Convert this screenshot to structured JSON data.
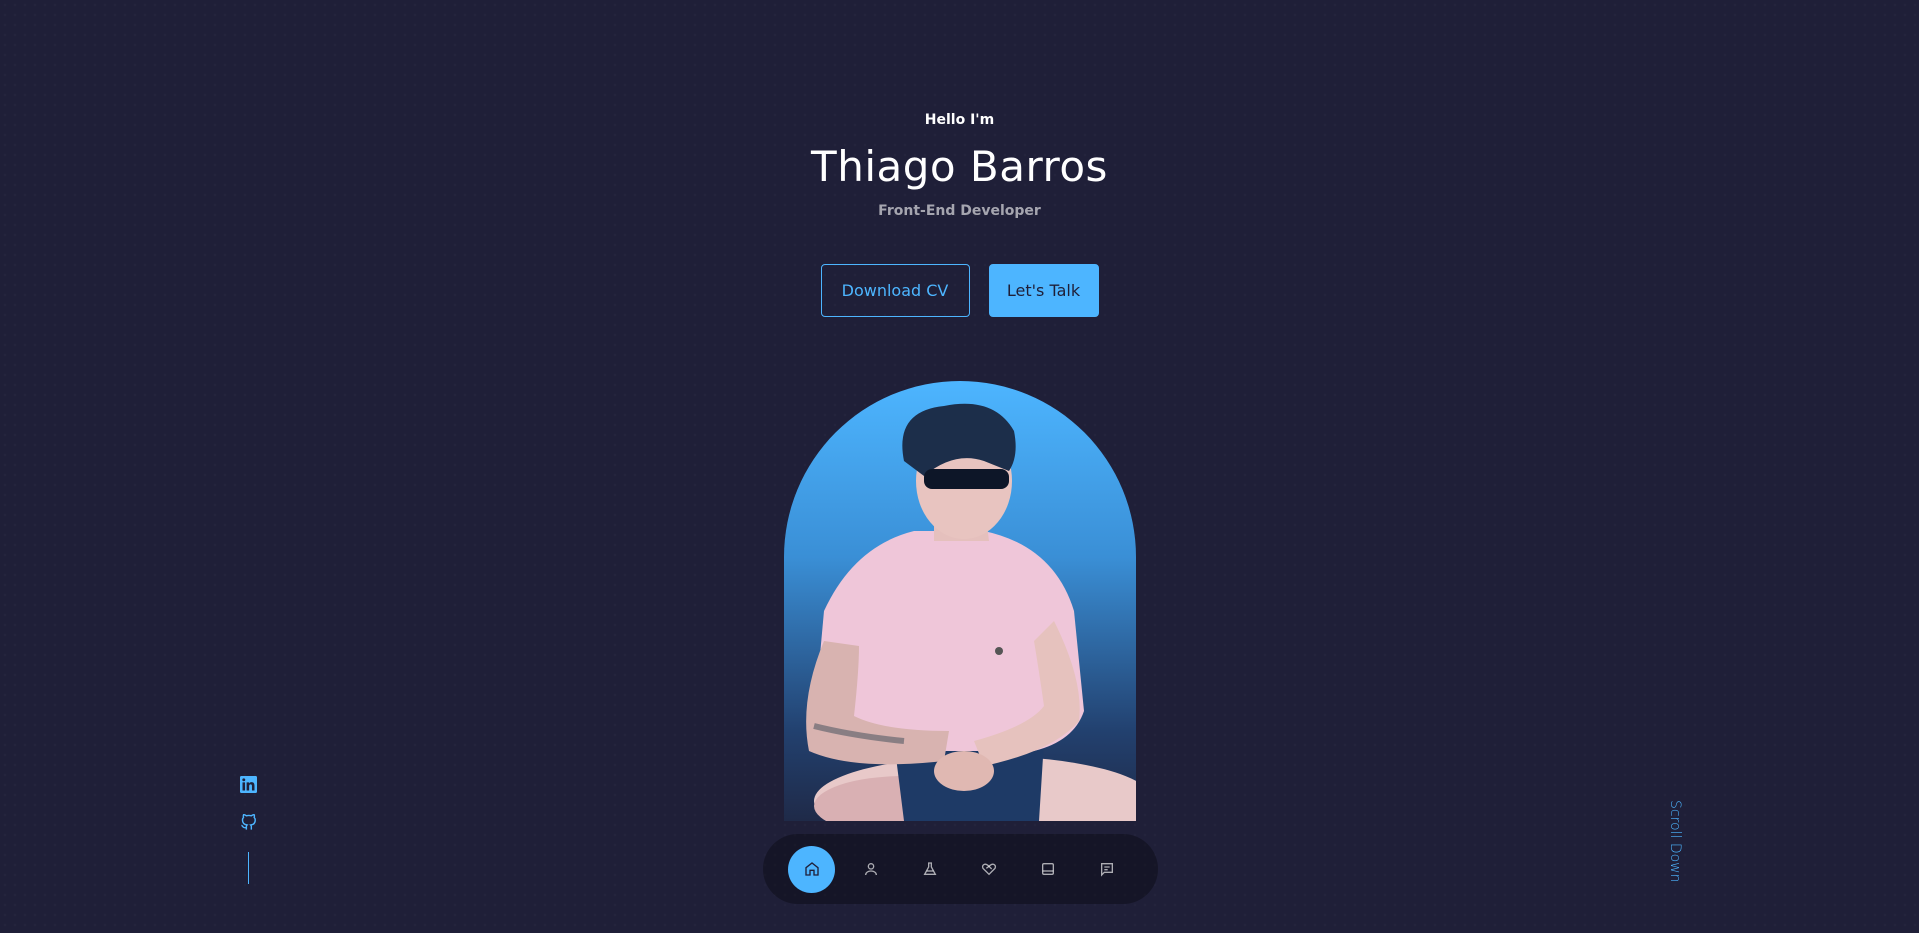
{
  "hero": {
    "greeting": "Hello I'm",
    "name": "Thiago Barros",
    "role": "Front-End Developer",
    "download_cv_label": "Download CV",
    "lets_talk_label": "Let's Talk"
  },
  "portrait": {
    "alt": "Thiago Barros"
  },
  "socials": [
    {
      "name": "linkedin-icon"
    },
    {
      "name": "github-icon"
    }
  ],
  "scroll_down_label": "Scroll Down",
  "nav": {
    "items": [
      {
        "icon": "home-icon",
        "active": true
      },
      {
        "icon": "user-icon",
        "active": false
      },
      {
        "icon": "flask-icon",
        "active": false
      },
      {
        "icon": "handshake-icon",
        "active": false
      },
      {
        "icon": "book-icon",
        "active": false
      },
      {
        "icon": "message-icon",
        "active": false
      }
    ]
  },
  "colors": {
    "background": "#1f1f38",
    "primary": "#4db5ff",
    "text_light": "rgba(255,255,255,0.6)"
  }
}
